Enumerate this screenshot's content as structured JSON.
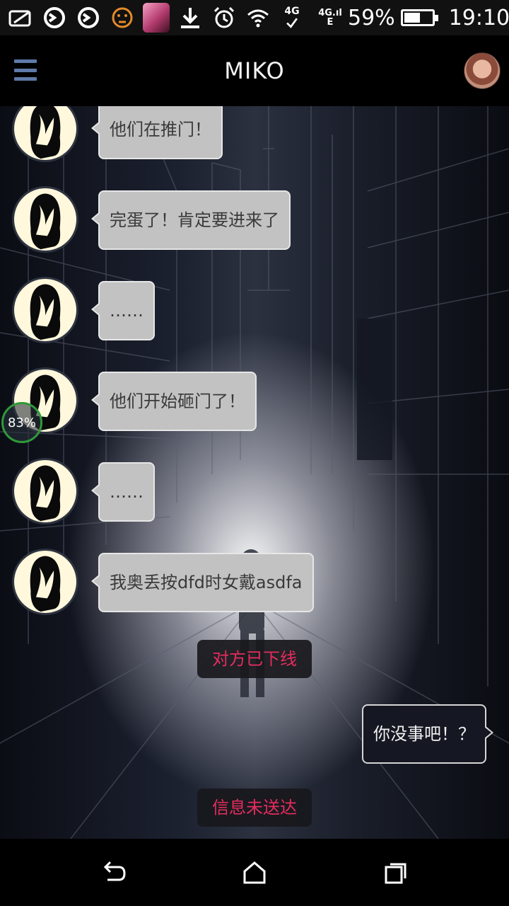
{
  "status_bar": {
    "battery_percent": "59%",
    "battery_level": 0.59,
    "time": "19:10",
    "network": "4G",
    "network_secondary": "E",
    "icons": [
      "image-icon",
      "sync-icon",
      "sync-icon",
      "emoji-icon",
      "app-icon",
      "download-icon",
      "alarm-icon",
      "wifi-icon",
      "network-4g-icon",
      "battery-icon"
    ]
  },
  "header": {
    "title": "MIKO"
  },
  "floating_widget": {
    "label": "83%"
  },
  "messages": [
    {
      "from": "other",
      "text": "他们在推门！"
    },
    {
      "from": "other",
      "text": "完蛋了！肯定要进来了"
    },
    {
      "from": "other",
      "text": "……"
    },
    {
      "from": "other",
      "text": "他们开始砸门了！"
    },
    {
      "from": "other",
      "text": "……"
    },
    {
      "from": "other",
      "text": "我奥丢按dfd时女戴asdfa"
    },
    {
      "from": "system",
      "text": "对方已下线"
    },
    {
      "from": "me",
      "text": "你没事吧！？"
    },
    {
      "from": "system",
      "text": "信息未送达"
    }
  ],
  "colors": {
    "system_text": "#e62c5e",
    "menu_icon": "#5e7aa8",
    "incoming_bubble": "#c2c2c2",
    "outgoing_bubble": "#151822"
  },
  "nav": {
    "icons": [
      "back-icon",
      "home-icon",
      "recents-icon"
    ]
  }
}
